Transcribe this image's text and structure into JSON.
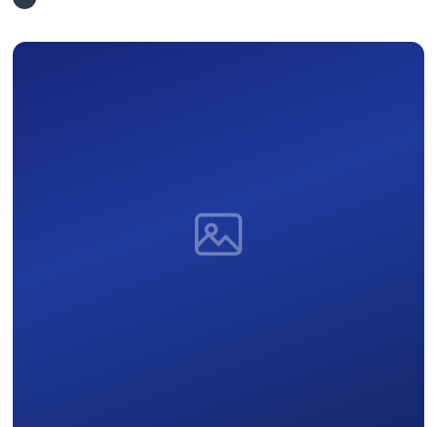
{
  "post": {
    "author_handle": "",
    "text": "",
    "media": {
      "alt_badge": "",
      "background_color": "#1e3a9c"
    }
  }
}
